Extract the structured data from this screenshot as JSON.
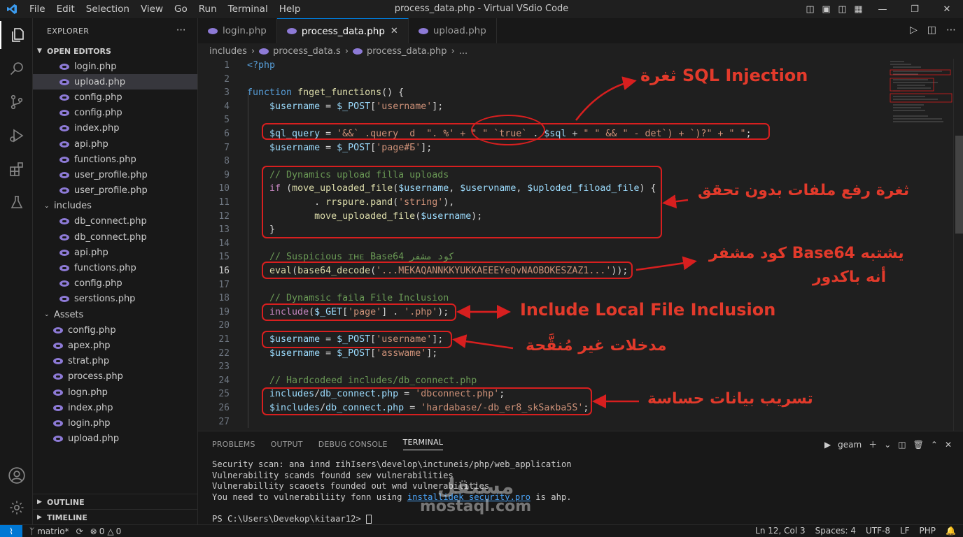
{
  "window": {
    "title": "process_data.php - Virtual VSdio Code",
    "menu": [
      "File",
      "Edit",
      "Selection",
      "View",
      "Go",
      "Run",
      "Terminal",
      "Help"
    ]
  },
  "explorer": {
    "header": "EXPLORER",
    "open_editors_label": "OPEN EDITORS",
    "open_editors": [
      "login.php",
      "upload.php",
      "config.php",
      "config.php",
      "index.php",
      "api.php",
      "functions.php",
      "user_profile.php",
      "user_profile.php"
    ],
    "includes_label": "includes",
    "includes": [
      "db_connect.php",
      "db_connect.php",
      "api.php",
      "functions.php",
      "config.php",
      "serstions.php"
    ],
    "assets_label": "Assets",
    "assets": [
      "config.php",
      "apex.php",
      "strat.php",
      "process.php",
      "logn.php",
      "index.php",
      "login.php",
      "upload.php"
    ],
    "outline_label": "OUTLINE",
    "timeline_label": "TIMELINE"
  },
  "tabs": [
    "login.php",
    "process_data.php",
    "upload.php"
  ],
  "breadcrumb": [
    "includes",
    "process_data.s",
    "process_data.php",
    "..."
  ],
  "code_lines": [
    {
      "n": "1",
      "parts": [
        [
          "kw",
          "<?php"
        ]
      ]
    },
    {
      "n": "2",
      "parts": []
    },
    {
      "n": "3",
      "parts": [
        [
          "kw",
          "function "
        ],
        [
          "fn",
          "fnget_functions"
        ],
        [
          "pun",
          "() {"
        ]
      ]
    },
    {
      "n": "4",
      "parts": [
        [
          "pun",
          "    "
        ],
        [
          "var",
          "$username"
        ],
        [
          "pun",
          " = "
        ],
        [
          "var",
          "$_POST"
        ],
        [
          "pun",
          "["
        ],
        [
          "str",
          "'username'"
        ],
        [
          "pun",
          "];"
        ]
      ]
    },
    {
      "n": "5",
      "parts": []
    },
    {
      "n": "6",
      "parts": [
        [
          "pun",
          "    "
        ],
        [
          "var",
          "$ql_query"
        ],
        [
          "pun",
          " = "
        ],
        [
          "str",
          "'&&` .query  d  \". %' + \" \" `true` "
        ],
        [
          "pun",
          ". "
        ],
        [
          "var",
          "$sql"
        ],
        [
          "pun",
          " + "
        ],
        [
          "str",
          "\" \" && \" - det`) + `)?\" + \" \""
        ],
        [
          "pun",
          ";"
        ]
      ]
    },
    {
      "n": "7",
      "parts": [
        [
          "pun",
          "    "
        ],
        [
          "var",
          "$username"
        ],
        [
          "pun",
          " = "
        ],
        [
          "var",
          "$_POST"
        ],
        [
          "pun",
          "["
        ],
        [
          "str",
          "'page#Б'"
        ],
        [
          "pun",
          "];"
        ]
      ]
    },
    {
      "n": "8",
      "parts": []
    },
    {
      "n": "9",
      "parts": [
        [
          "pun",
          "    "
        ],
        [
          "cm",
          "// Dynamics upload filla uploads"
        ]
      ]
    },
    {
      "n": "10",
      "parts": [
        [
          "pun",
          "    "
        ],
        [
          "kw2",
          "if "
        ],
        [
          "pun",
          "("
        ],
        [
          "fn",
          "move_uploaded_file"
        ],
        [
          "pun",
          "("
        ],
        [
          "var",
          "$username"
        ],
        [
          "pun",
          ", "
        ],
        [
          "var",
          "$userνname"
        ],
        [
          "pun",
          ", "
        ],
        [
          "var",
          "$uploded_fiload_file"
        ],
        [
          "pun",
          ") {"
        ]
      ]
    },
    {
      "n": "11",
      "parts": [
        [
          "pun",
          "            . "
        ],
        [
          "fn",
          "rrspure.pand"
        ],
        [
          "pun",
          "("
        ],
        [
          "str",
          "'string'"
        ],
        [
          "pun",
          "),"
        ]
      ]
    },
    {
      "n": "12",
      "parts": [
        [
          "pun",
          "            "
        ],
        [
          "fn",
          "move_uploaded_file"
        ],
        [
          "pun",
          "("
        ],
        [
          "var",
          "$username"
        ],
        [
          "pun",
          ");"
        ]
      ]
    },
    {
      "n": "13",
      "parts": [
        [
          "pun",
          "    }"
        ]
      ]
    },
    {
      "n": "14",
      "parts": []
    },
    {
      "n": "15",
      "parts": [
        [
          "pun",
          "    "
        ],
        [
          "cm",
          "// Suspicious ɪʜᴇ Base64 كود مشفر"
        ]
      ]
    },
    {
      "n": "16",
      "parts": [
        [
          "pun",
          "    "
        ],
        [
          "fn",
          "eval"
        ],
        [
          "pun",
          "("
        ],
        [
          "fn",
          "base64_decode"
        ],
        [
          "pun",
          "("
        ],
        [
          "str",
          "'...MEKAQANNKKYUKKAEEEYeQvNAOBOKESZAZ1...'"
        ],
        [
          "pun",
          "));"
        ]
      ]
    },
    {
      "n": "17",
      "parts": []
    },
    {
      "n": "18",
      "parts": [
        [
          "pun",
          "    "
        ],
        [
          "cm",
          "// Dynamsic faila File Inclusion"
        ]
      ]
    },
    {
      "n": "19",
      "parts": [
        [
          "pun",
          "    "
        ],
        [
          "kw2",
          "include"
        ],
        [
          "pun",
          "("
        ],
        [
          "var",
          "$_GET"
        ],
        [
          "pun",
          "["
        ],
        [
          "str",
          "'page'"
        ],
        [
          "pun",
          "] . "
        ],
        [
          "str",
          "'.php'"
        ],
        [
          "pun",
          ");"
        ]
      ]
    },
    {
      "n": "20",
      "parts": []
    },
    {
      "n": "21",
      "parts": [
        [
          "pun",
          "    "
        ],
        [
          "var",
          "$username"
        ],
        [
          "pun",
          " = "
        ],
        [
          "var",
          "$_POST"
        ],
        [
          "pun",
          "["
        ],
        [
          "str",
          "'username'"
        ],
        [
          "pun",
          "];"
        ]
      ]
    },
    {
      "n": "22",
      "parts": [
        [
          "pun",
          "    "
        ],
        [
          "var",
          "$username"
        ],
        [
          "pun",
          " = "
        ],
        [
          "var",
          "$_POST"
        ],
        [
          "pun",
          "["
        ],
        [
          "str",
          "'asswame'"
        ],
        [
          "pun",
          "];"
        ]
      ]
    },
    {
      "n": "23",
      "parts": []
    },
    {
      "n": "24",
      "parts": [
        [
          "pun",
          "    "
        ],
        [
          "cm",
          "// Hardcodeed includes/db_connect.php"
        ]
      ]
    },
    {
      "n": "25",
      "parts": [
        [
          "pun",
          "    "
        ],
        [
          "var",
          "includes"
        ],
        [
          "pun",
          "/"
        ],
        [
          "var",
          "db_connect.php"
        ],
        [
          "pun",
          " = "
        ],
        [
          "str",
          "'dbconnect.php'"
        ],
        [
          "pun",
          ";"
        ]
      ]
    },
    {
      "n": "26",
      "parts": [
        [
          "pun",
          "    "
        ],
        [
          "var",
          "$includes"
        ],
        [
          "pun",
          "/"
        ],
        [
          "var",
          "db_connect.php"
        ],
        [
          "pun",
          " = "
        ],
        [
          "str",
          "'hardabase/-db_er8_skSaĸba5S'"
        ],
        [
          "pun",
          ";"
        ]
      ]
    },
    {
      "n": "27",
      "parts": []
    }
  ],
  "current_line": "16",
  "annotations": {
    "sql_injection": "ثغرة SQL Injection",
    "file_upload": "ثغرة رفع ملفات بدون تحقق",
    "base64_line1": "كود مشفر Base64 يشتبه",
    "base64_line2": "أنه باكدور",
    "lfi": "Include Local File Inclusion",
    "unsanitized": "مدخلات غير مُنقَّحة",
    "data_leak": "تسريب بيانات حساسة",
    "color": "#e23a2b"
  },
  "panel": {
    "tabs": [
      "PROBLEMS",
      "OUTPUT",
      "DEBUG CONSOLE",
      "TERMINAL"
    ],
    "active_tab": "TERMINAL",
    "terminal_name": "geam",
    "lines": [
      "Security scan: ana innd ɪihIsers\\develop\\inctuneis/php/web_application",
      "Vulnerability scands foundd sew vulnerabilities",
      "Vulnerabillity scaoets founded out wnd vulnerabilities",
      "You need to vulnerabiliity fonn using ",
      "",
      "PS C:\\Users\\Devekop\\kitaar12> "
    ],
    "link_text": "installidek security.pro",
    "link_tail": " is ahp."
  },
  "watermark": {
    "arabic": "مستقل",
    "latin": "mostaql.com"
  },
  "statusbar": {
    "branch": "matrio*",
    "errors": "0",
    "warnings": "0",
    "position": "Ln 12, Col 3",
    "spaces": "Spaces: 4",
    "encoding": "UTF-8",
    "eol": "LF",
    "language": "PHP"
  }
}
